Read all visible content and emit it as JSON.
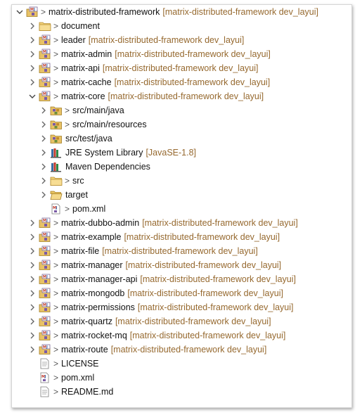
{
  "colors": {
    "decoration": "#96692f",
    "text": "#111111"
  },
  "tree": [
    {
      "id": "root",
      "label": "matrix-distributed-framework",
      "decoration": "[matrix-distributed-framework dev_layui]",
      "icon": "maven-project-icon",
      "expanded": true,
      "marker": ">"
    },
    {
      "id": "document",
      "label": "document",
      "decoration": "",
      "icon": "folder-icon",
      "expanded": false,
      "marker": ">"
    },
    {
      "id": "leader",
      "label": "leader",
      "decoration": "[matrix-distributed-framework dev_layui]",
      "icon": "maven-project-icon",
      "expanded": false,
      "marker": ">"
    },
    {
      "id": "matrix-admin",
      "label": "matrix-admin",
      "decoration": "[matrix-distributed-framework dev_layui]",
      "icon": "maven-project-icon",
      "expanded": false,
      "marker": ">"
    },
    {
      "id": "matrix-api",
      "label": "matrix-api",
      "decoration": "[matrix-distributed-framework dev_layui]",
      "icon": "maven-project-icon",
      "expanded": false,
      "marker": ">"
    },
    {
      "id": "matrix-cache",
      "label": "matrix-cache",
      "decoration": "[matrix-distributed-framework dev_layui]",
      "icon": "maven-project-icon",
      "expanded": false,
      "marker": ">"
    },
    {
      "id": "matrix-core",
      "label": "matrix-core",
      "decoration": "[matrix-distributed-framework dev_layui]",
      "icon": "maven-project-icon",
      "expanded": true,
      "marker": ">"
    },
    {
      "id": "src-main-java",
      "label": "src/main/java",
      "decoration": "",
      "icon": "source-folder-icon",
      "expanded": false,
      "marker": ">"
    },
    {
      "id": "src-main-resources",
      "label": "src/main/resources",
      "decoration": "",
      "icon": "source-folder-icon",
      "expanded": false,
      "marker": ">"
    },
    {
      "id": "src-test-java",
      "label": "src/test/java",
      "decoration": "",
      "icon": "source-folder-icon",
      "expanded": false,
      "marker": ""
    },
    {
      "id": "jre",
      "label": "JRE System Library",
      "decoration": "[JavaSE-1.8]",
      "icon": "library-icon",
      "expanded": false,
      "marker": ""
    },
    {
      "id": "maven-deps",
      "label": "Maven Dependencies",
      "decoration": "",
      "icon": "library-icon",
      "expanded": false,
      "marker": ""
    },
    {
      "id": "src",
      "label": "src",
      "decoration": "",
      "icon": "folder-icon",
      "expanded": false,
      "marker": ">"
    },
    {
      "id": "target",
      "label": "target",
      "decoration": "",
      "icon": "open-folder-icon",
      "expanded": false,
      "marker": ""
    },
    {
      "id": "core-pom",
      "label": "pom.xml",
      "decoration": "",
      "icon": "xml-file-icon",
      "expanded": null,
      "marker": ">"
    },
    {
      "id": "matrix-dubbo-admin",
      "label": "matrix-dubbo-admin",
      "decoration": "[matrix-distributed-framework dev_layui]",
      "icon": "maven-project-icon",
      "expanded": false,
      "marker": ">"
    },
    {
      "id": "matrix-example",
      "label": "matrix-example",
      "decoration": "[matrix-distributed-framework dev_layui]",
      "icon": "maven-project-icon",
      "expanded": false,
      "marker": ">"
    },
    {
      "id": "matrix-file",
      "label": "matrix-file",
      "decoration": "[matrix-distributed-framework dev_layui]",
      "icon": "maven-project-icon",
      "expanded": false,
      "marker": ">"
    },
    {
      "id": "matrix-manager",
      "label": "matrix-manager",
      "decoration": "[matrix-distributed-framework dev_layui]",
      "icon": "maven-project-icon",
      "expanded": false,
      "marker": ">"
    },
    {
      "id": "matrix-manager-api",
      "label": "matrix-manager-api",
      "decoration": "[matrix-distributed-framework dev_layui]",
      "icon": "maven-project-icon",
      "expanded": false,
      "marker": ">"
    },
    {
      "id": "matrix-mongodb",
      "label": "matrix-mongodb",
      "decoration": "[matrix-distributed-framework dev_layui]",
      "icon": "maven-project-icon",
      "expanded": false,
      "marker": ">"
    },
    {
      "id": "matrix-permissions",
      "label": "matrix-permissions",
      "decoration": "[matrix-distributed-framework dev_layui]",
      "icon": "maven-project-icon",
      "expanded": false,
      "marker": ">"
    },
    {
      "id": "matrix-quartz",
      "label": "matrix-quartz",
      "decoration": "[matrix-distributed-framework dev_layui]",
      "icon": "maven-project-icon",
      "expanded": false,
      "marker": ">"
    },
    {
      "id": "matrix-rocket-mq",
      "label": "matrix-rocket-mq",
      "decoration": "[matrix-distributed-framework dev_layui]",
      "icon": "maven-project-icon",
      "expanded": false,
      "marker": ">"
    },
    {
      "id": "matrix-route",
      "label": "matrix-route",
      "decoration": "[matrix-distributed-framework dev_layui]",
      "icon": "maven-project-icon",
      "expanded": false,
      "marker": ">"
    },
    {
      "id": "license",
      "label": "LICENSE",
      "decoration": "",
      "icon": "text-file-icon",
      "expanded": null,
      "marker": ">"
    },
    {
      "id": "pom",
      "label": "pom.xml",
      "decoration": "",
      "icon": "xml-file-icon",
      "expanded": null,
      "marker": ">"
    },
    {
      "id": "readme",
      "label": "README.md",
      "decoration": "",
      "icon": "text-file-icon",
      "expanded": null,
      "marker": ">"
    }
  ]
}
